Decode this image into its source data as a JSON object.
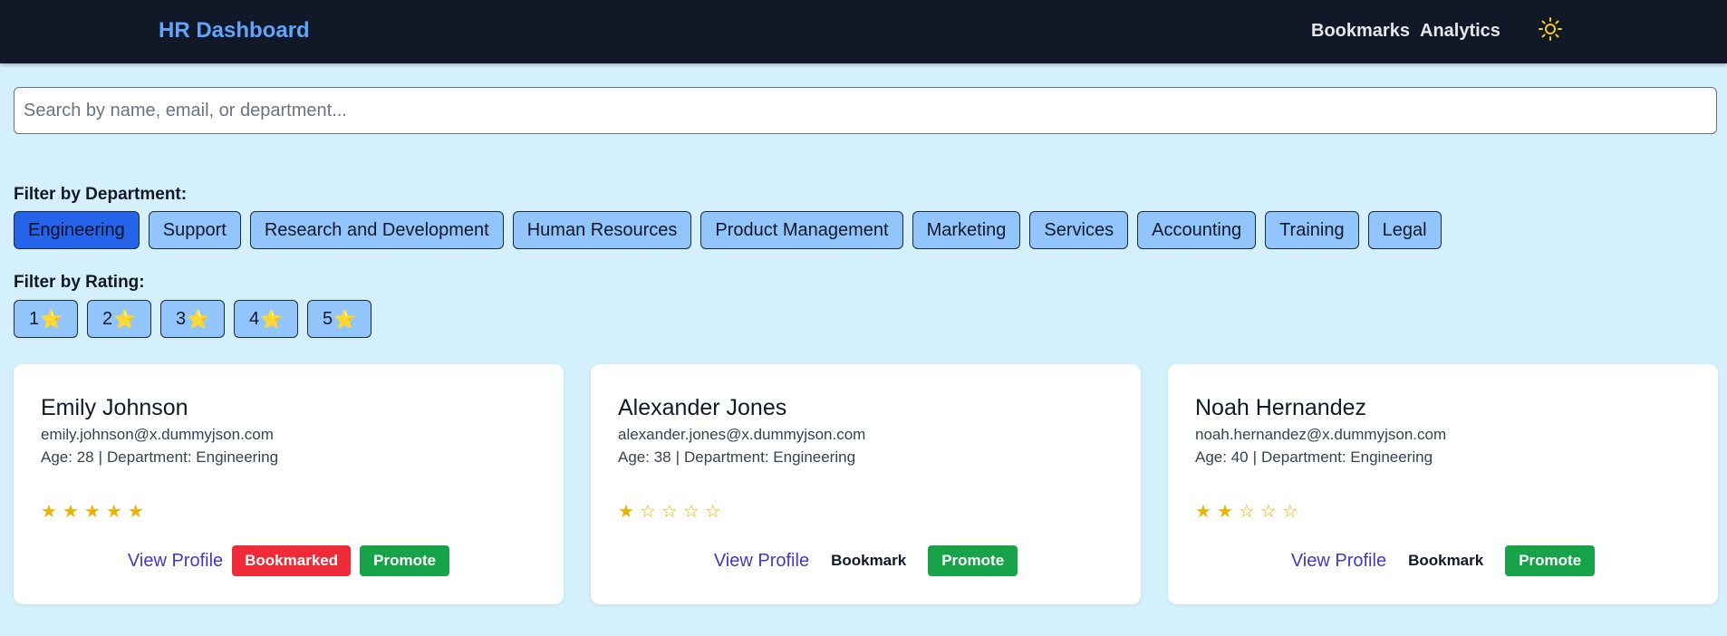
{
  "header": {
    "brand": "HR Dashboard",
    "links": [
      "Bookmarks",
      "Analytics"
    ],
    "theme_icon": "sun-icon"
  },
  "search": {
    "placeholder": "Search by name, email, or department...",
    "value": ""
  },
  "filters": {
    "department_label": "Filter by Department:",
    "departments": [
      "Engineering",
      "Support",
      "Research and Development",
      "Human Resources",
      "Product Management",
      "Marketing",
      "Services",
      "Accounting",
      "Training",
      "Legal"
    ],
    "active_department": "Engineering",
    "rating_label": "Filter by Rating:",
    "ratings": [
      "1",
      "2",
      "3",
      "4",
      "5"
    ],
    "rating_star": "⭐"
  },
  "employees": [
    {
      "name": "Emily Johnson",
      "email": "emily.johnson@x.dummyjson.com",
      "age_text": "Age: 28",
      "department_text": "Department: Engineering",
      "rating": 5,
      "view_label": "View Profile",
      "bookmark_label": "Bookmarked",
      "bookmarked": true,
      "promote_label": "Promote"
    },
    {
      "name": "Alexander Jones",
      "email": "alexander.jones@x.dummyjson.com",
      "age_text": "Age: 38",
      "department_text": "Department: Engineering",
      "rating": 1,
      "view_label": "View Profile",
      "bookmark_label": "Bookmark",
      "bookmarked": false,
      "promote_label": "Promote"
    },
    {
      "name": "Noah Hernandez",
      "email": "noah.hernandez@x.dummyjson.com",
      "age_text": "Age: 40",
      "department_text": "Department: Engineering",
      "rating": 2,
      "view_label": "View Profile",
      "bookmark_label": "Bookmark",
      "bookmarked": false,
      "promote_label": "Promote"
    }
  ],
  "colors": {
    "background": "#d4f0fb",
    "navbar": "#111827",
    "brand": "#60a5fa",
    "chip": "#93c5fd",
    "chip_active": "#2563eb",
    "bookmarked": "#ef2b3a",
    "promote": "#16a34a",
    "star": "#eab308"
  }
}
